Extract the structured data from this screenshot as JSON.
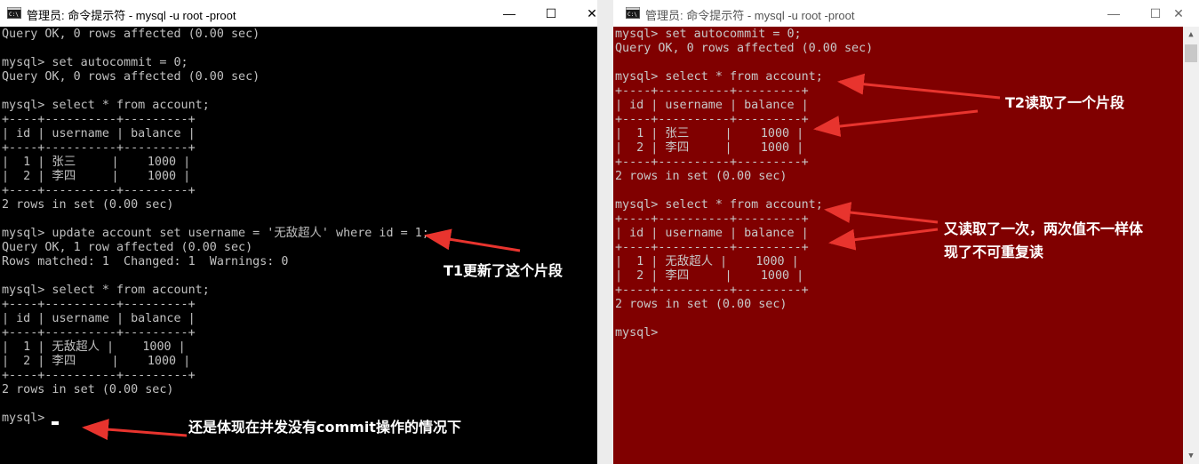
{
  "left_window": {
    "title": "管理员: 命令提示符 - mysql  -u root -proot",
    "lines": [
      "Query OK, 0 rows affected (0.00 sec)",
      "",
      "mysql> set autocommit = 0;",
      "Query OK, 0 rows affected (0.00 sec)",
      "",
      "mysql> select * from account;",
      "+----+----------+---------+",
      "| id | username | balance |",
      "+----+----------+---------+",
      "|  1 | 张三     |    1000 |",
      "|  2 | 李四     |    1000 |",
      "+----+----------+---------+",
      "2 rows in set (0.00 sec)",
      "",
      "mysql> update account set username = '无敌超人' where id = 1;",
      "Query OK, 1 row affected (0.00 sec)",
      "Rows matched: 1  Changed: 1  Warnings: 0",
      "",
      "mysql> select * from account;",
      "+----+----------+---------+",
      "| id | username | balance |",
      "+----+----------+---------+",
      "|  1 | 无敌超人 |    1000 |",
      "|  2 | 李四     |    1000 |",
      "+----+----------+---------+",
      "2 rows in set (0.00 sec)",
      "",
      "mysql> "
    ]
  },
  "right_window": {
    "title": "管理员: 命令提示符 - mysql  -u root -proot",
    "lines": [
      "mysql> set autocommit = 0;",
      "Query OK, 0 rows affected (0.00 sec)",
      "",
      "mysql> select * from account;",
      "+----+----------+---------+",
      "| id | username | balance |",
      "+----+----------+---------+",
      "|  1 | 张三     |    1000 |",
      "|  2 | 李四     |    1000 |",
      "+----+----------+---------+",
      "2 rows in set (0.00 sec)",
      "",
      "mysql> select * from account;",
      "+----+----------+---------+",
      "| id | username | balance |",
      "+----+----------+---------+",
      "|  1 | 无敌超人 |    1000 |",
      "|  2 | 李四     |    1000 |",
      "+----+----------+---------+",
      "2 rows in set (0.00 sec)",
      "",
      "mysql>"
    ]
  },
  "annotations": {
    "t1": "T1更新了这个片段",
    "t2": "T2读取了一个片段",
    "again_line1": "又读取了一次，两次值不一样体",
    "again_line2": "现了不可重复读",
    "bottom": "还是体现在并发没有commit操作的情况下"
  },
  "colors": {
    "left_console_bg": "#000000",
    "right_console_bg": "#800000",
    "console_text": "#c0c0c0",
    "arrow": "#e8342e"
  },
  "icons": {
    "window_icon": "cmd-icon",
    "minimize": "minimize-icon",
    "maximize": "maximize-icon",
    "close": "close-icon"
  },
  "window_buttons": {
    "minimize": "—",
    "maximize": "☐",
    "close": "✕"
  }
}
